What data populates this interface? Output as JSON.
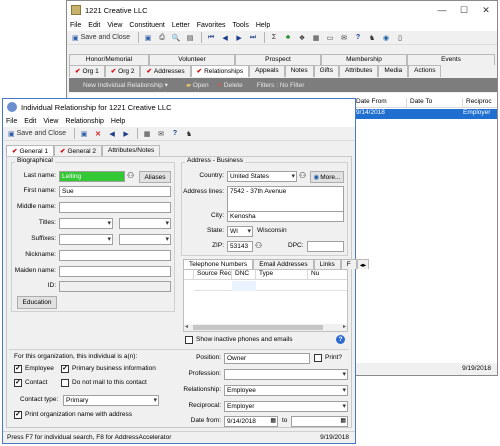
{
  "bg_window": {
    "title": "1221 Creative LLC",
    "menu": [
      "File",
      "Edit",
      "View",
      "Constituent",
      "Letter",
      "Favorites",
      "Tools",
      "Help"
    ],
    "toolbar": {
      "save_close": "Save and Close"
    },
    "tabs_top": [
      "Honor/Memorial",
      "Volunteer",
      "Prospect",
      "Membership",
      "Events"
    ],
    "tabs_bottom": [
      "Org 1",
      "Org 2",
      "Addresses",
      "Relationships",
      "Appeals",
      "Notes",
      "Gifts",
      "Attributes",
      "Media",
      "Actions"
    ],
    "rel_toolbar": {
      "new": "New Individual Relationship",
      "open": "Open",
      "delete": "Delete",
      "filters": "Filters : No Filter"
    },
    "grid_headers": [
      "Date From",
      "Date To",
      "Reciproc"
    ],
    "grid_row": {
      "date_from": "9/14/2018",
      "reciprocal": "Employer"
    },
    "status_date": "9/19/2018"
  },
  "dialog": {
    "title": "Individual Relationship for 1221 Creative LLC",
    "menu": [
      "File",
      "Edit",
      "View",
      "Relationship",
      "Help"
    ],
    "toolbar": {
      "save_close": "Save and Close"
    },
    "tabs": [
      "General 1",
      "General 2",
      "Attributes/Notes"
    ],
    "biographical": {
      "legend": "Biographical",
      "last_name_label": "Last name:",
      "last_name": "Leiting",
      "aliases": "Aliases",
      "first_name_label": "First name:",
      "first_name": "Sue",
      "middle_name_label": "Middle name:",
      "titles_label": "Titles:",
      "suffixes_label": "Suffixes:",
      "nickname_label": "Nickname:",
      "maiden_name_label": "Maiden name:",
      "id_label": "ID:",
      "education": "Education"
    },
    "address": {
      "legend": "Address - Business",
      "country_label": "Country:",
      "country": "United States",
      "more": "More...",
      "address_lines_label": "Address lines:",
      "address_lines": "7542 - 37th Avenue",
      "city_label": "City:",
      "city": "Kenosha",
      "state_label": "State:",
      "state": "WI",
      "state_name": "Wisconsin",
      "zip_label": "ZIP:",
      "zip": "53143",
      "dpc_label": "DPC:"
    },
    "phone_tabs": [
      "Telephone Numbers",
      "Email Addresses",
      "Links",
      "F"
    ],
    "phone_headers": [
      "Source Rec",
      "DNC",
      "Type",
      "Nu"
    ],
    "show_inactive": "Show inactive phones and emails",
    "org": {
      "heading": "For this organization, this individual is a(n):",
      "employee": "Employee",
      "primary_business": "Primary business information",
      "contact": "Contact",
      "do_not_mail": "Do not mail to this contact",
      "contact_type_label": "Contact type:",
      "contact_type": "Primary",
      "print_org": "Print organization name with address"
    },
    "relation": {
      "position_label": "Position:",
      "position": "Owner",
      "print_label": "Print?",
      "profession_label": "Profession:",
      "relationship_label": "Relationship:",
      "relationship": "Employee",
      "reciprocal_label": "Reciprocal:",
      "reciprocal": "Employer",
      "date_from_label": "Date from:",
      "date_from": "9/14/2018",
      "to_label": "to"
    },
    "status_hint": "Press F7 for individual search, F8 for AddressAccelerator",
    "status_date": "9/19/2018"
  }
}
